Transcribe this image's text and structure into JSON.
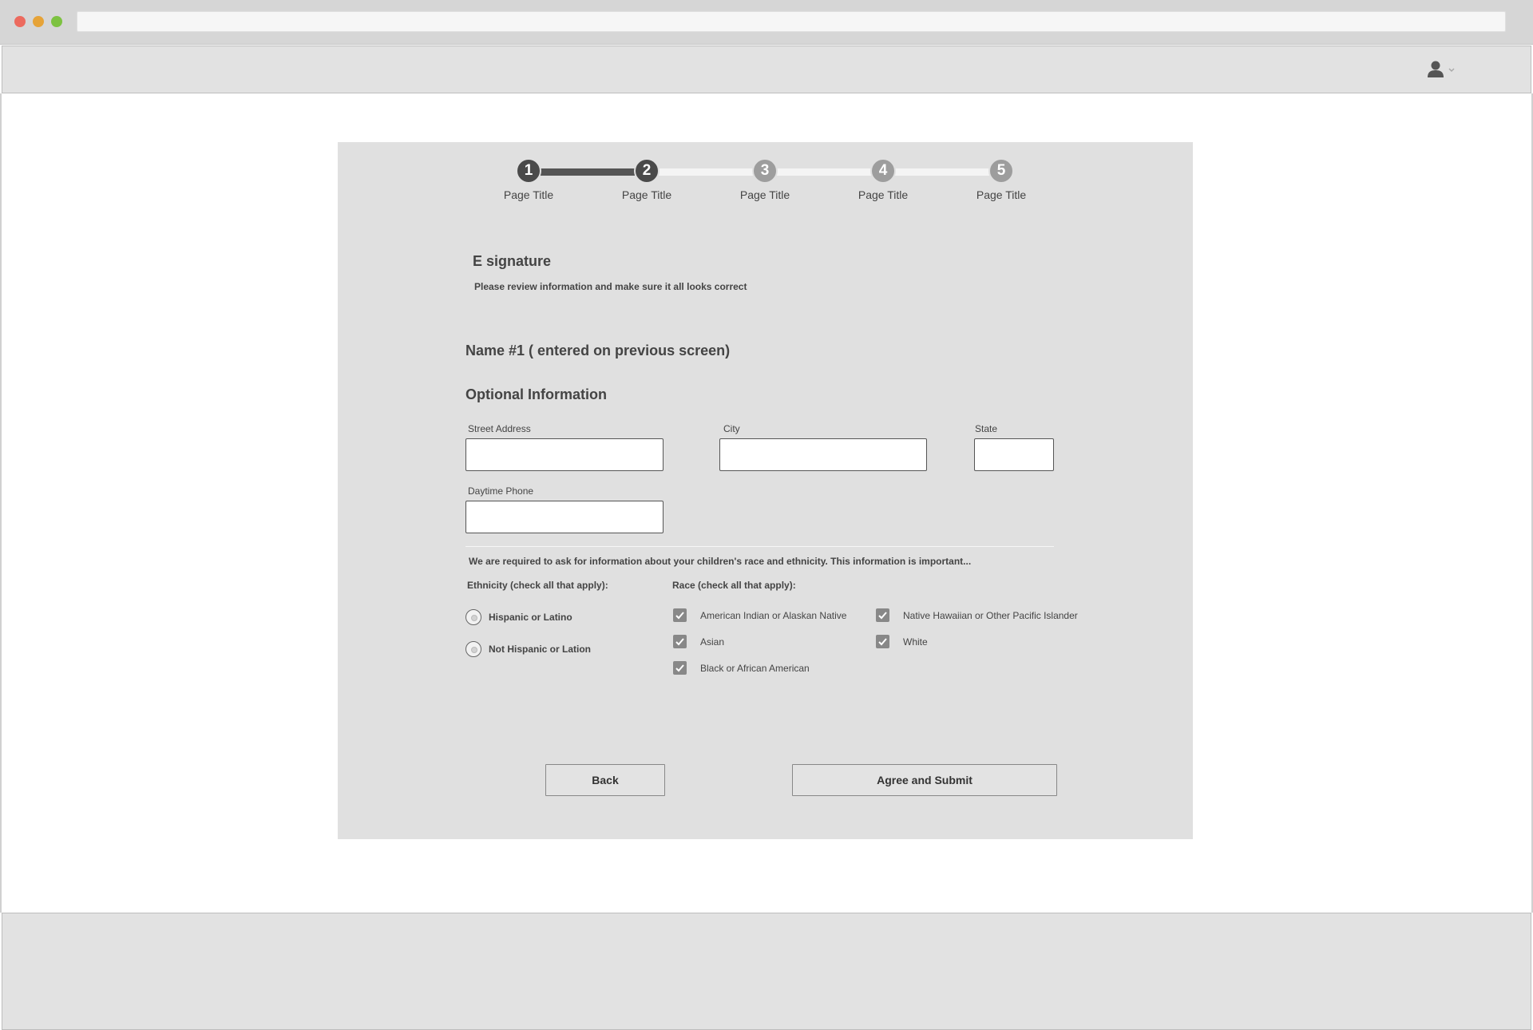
{
  "stepper": {
    "steps": [
      {
        "number": "1",
        "label": "Page Title",
        "state": "complete"
      },
      {
        "number": "2",
        "label": "Page Title",
        "state": "current"
      },
      {
        "number": "3",
        "label": "Page Title",
        "state": "upcoming"
      },
      {
        "number": "4",
        "label": "Page Title",
        "state": "upcoming"
      },
      {
        "number": "5",
        "label": "Page Title",
        "state": "upcoming"
      }
    ]
  },
  "header": {
    "user_icon": "user-icon",
    "menu_icon": "chevron-down-icon"
  },
  "form": {
    "title": "E signature",
    "subtitle": "Please review information and make sure it all looks correct",
    "name_line": "Name #1 ( entered on previous screen)",
    "section_title": "Optional Information",
    "fields": {
      "street": {
        "label": "Street Address",
        "value": ""
      },
      "city": {
        "label": "City",
        "value": ""
      },
      "state": {
        "label": "State",
        "value": ""
      },
      "phone": {
        "label": "Daytime Phone",
        "value": ""
      }
    },
    "notice": "We are required to ask for information about your children's race and ethnicity.  This information is important...",
    "ethnicity": {
      "title": "Ethnicity (check all that apply):",
      "options": [
        "Hispanic or Latino",
        "Not Hispanic or Lation"
      ]
    },
    "race": {
      "title": "Race (check all that apply):",
      "options": [
        {
          "label": "American Indian or Alaskan Native",
          "checked": true
        },
        {
          "label": "Asian",
          "checked": true
        },
        {
          "label": "Black or African American",
          "checked": true
        },
        {
          "label": "Native Hawaiian or Other Pacific Islander",
          "checked": true
        },
        {
          "label": "White",
          "checked": true
        }
      ]
    },
    "buttons": {
      "back": "Back",
      "submit": "Agree and Submit"
    }
  },
  "colors": {
    "panel": "#e0e0e0",
    "active_step": "#4a4a4a",
    "inactive_step": "#9d9d9d"
  }
}
